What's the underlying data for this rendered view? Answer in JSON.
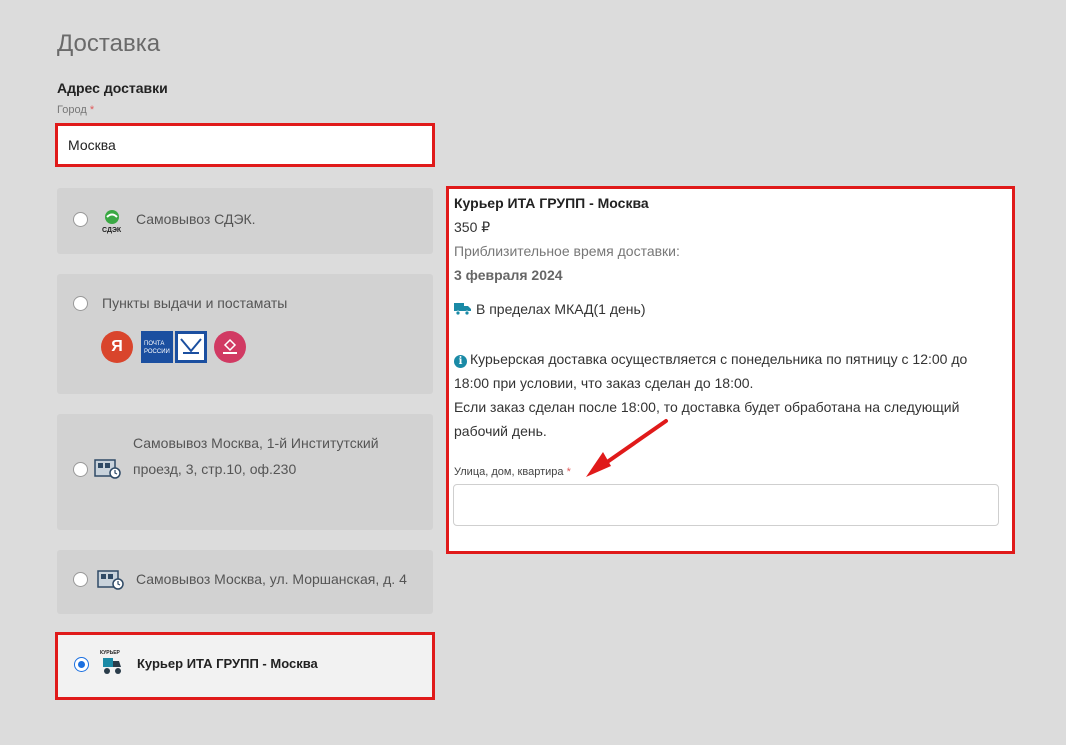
{
  "page": {
    "title": "Доставка",
    "section_title": "Адрес доставки"
  },
  "city": {
    "label": "Город",
    "required_mark": "*",
    "value": "Москва"
  },
  "options": [
    {
      "label": "Самовывоз СДЭК.",
      "icon": "cdek-logo-icon",
      "selected": false
    },
    {
      "label": "Пункты выдачи и постаматы",
      "icon": "pickup-points-icon",
      "selected": false,
      "logos": [
        {
          "name": "yandex-logo-icon",
          "text": "Я"
        },
        {
          "name": "pochta-rossii-logo-icon",
          "text": "ПОЧТА РОССИИ"
        },
        {
          "name": "pochta-emblem-icon",
          "text": ""
        },
        {
          "name": "wildberries-logo-icon",
          "text": ""
        }
      ]
    },
    {
      "label": "Самовывоз Москва, 1-й Институтский проезд, 3, стр.10, оф.230",
      "icon": "pickup-store-icon",
      "selected": false
    },
    {
      "label": "Самовывоз Москва, ул. Моршанская, д. 4",
      "icon": "pickup-store-icon",
      "selected": false
    },
    {
      "label": "Курьер ИТА ГРУПП - Москва",
      "icon": "courier-icon",
      "icon_text": "КУРЬЕР",
      "selected": true
    }
  ],
  "details": {
    "title": "Курьер ИТА ГРУПП - Москва",
    "price": "350 ₽",
    "eta_label": "Приблизительное время доставки:",
    "eta_date": "3 февраля 2024",
    "zone": "В пределах МКАД(1 день)",
    "info_line1": "Курьерская доставка осуществляется с понедельника по пятницу с 12:00 до 18:00 при условии, что заказ сделан до 18:00.",
    "info_line2": "Если заказ сделан после 18:00, то доставка будет обработана на следующий рабочий день.",
    "street_label": "Улица, дом, квартира",
    "street_required_mark": "*",
    "street_value": "",
    "street_placeholder": ""
  },
  "colors": {
    "highlight": "#e01a1a",
    "radio_selected": "#1a6fe0",
    "truck_icon": "#1a8aa6"
  }
}
